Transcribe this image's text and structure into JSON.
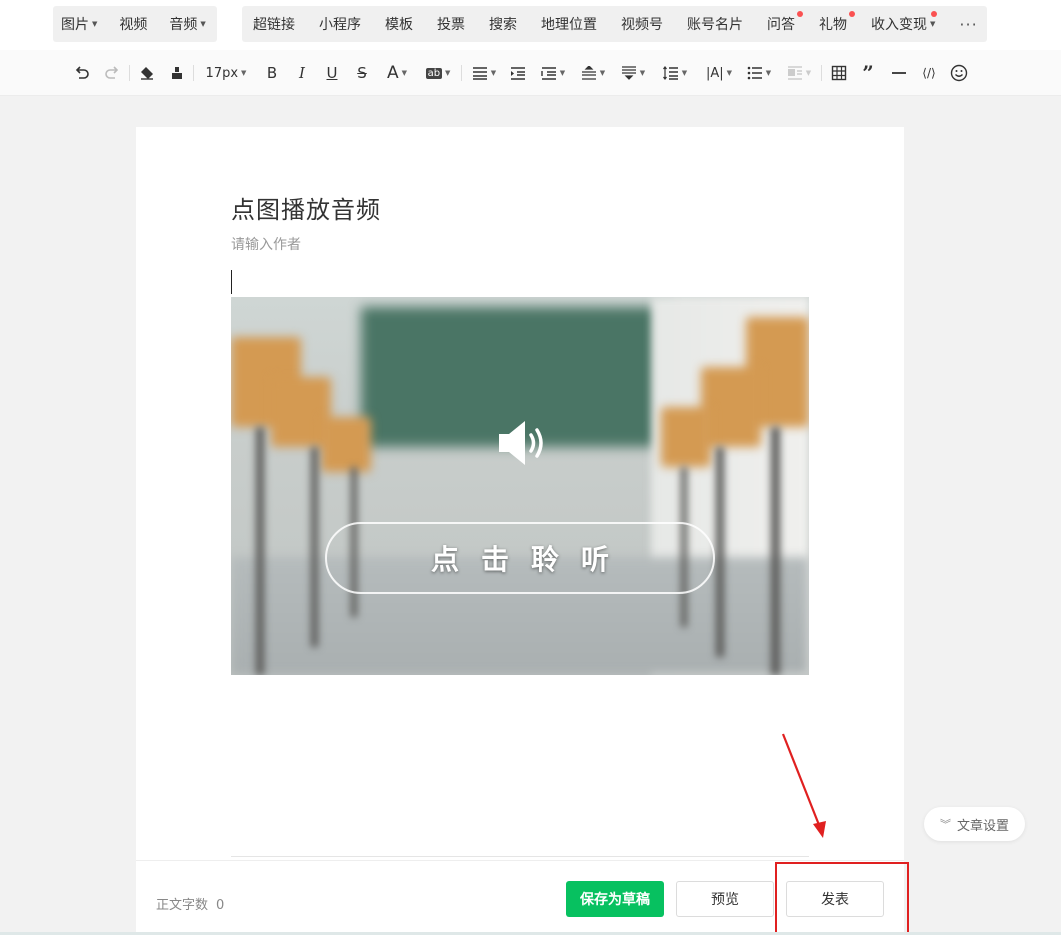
{
  "insert_bar": {
    "group1": [
      {
        "label": "图片",
        "dropdown": true
      },
      {
        "label": "视频",
        "dropdown": false
      },
      {
        "label": "音频",
        "dropdown": true
      }
    ],
    "group2": [
      {
        "label": "超链接",
        "dot": false
      },
      {
        "label": "小程序",
        "dot": false
      },
      {
        "label": "模板",
        "dot": false
      },
      {
        "label": "投票",
        "dot": false
      },
      {
        "label": "搜索",
        "dot": false
      },
      {
        "label": "地理位置",
        "dot": false
      },
      {
        "label": "视频号",
        "dot": false
      },
      {
        "label": "账号名片",
        "dot": false
      },
      {
        "label": "问答",
        "dot": true
      },
      {
        "label": "礼物",
        "dot": true
      },
      {
        "label": "收入变现",
        "dot": true,
        "dropdown": true
      }
    ],
    "more_label": "···"
  },
  "format_bar": {
    "font_size": "17px",
    "bold": "B",
    "italic": "I",
    "underline": "U",
    "strike": "S",
    "font_color": "A",
    "bg_color": "ab",
    "letter_spacing": "|A|"
  },
  "article": {
    "title": "点图播放音频",
    "author_placeholder": "请输入作者"
  },
  "audio_card": {
    "listen_label": "点击聆听",
    "icon": "speaker-icon"
  },
  "footer": {
    "word_count_label": "正文字数",
    "word_count": "0",
    "save_draft": "保存为草稿",
    "preview": "预览",
    "publish": "发表"
  },
  "settings_button": "文章设置",
  "colors": {
    "primary_green": "#07c160",
    "annotation_red": "#e02020",
    "dot_red": "#fa5151"
  }
}
